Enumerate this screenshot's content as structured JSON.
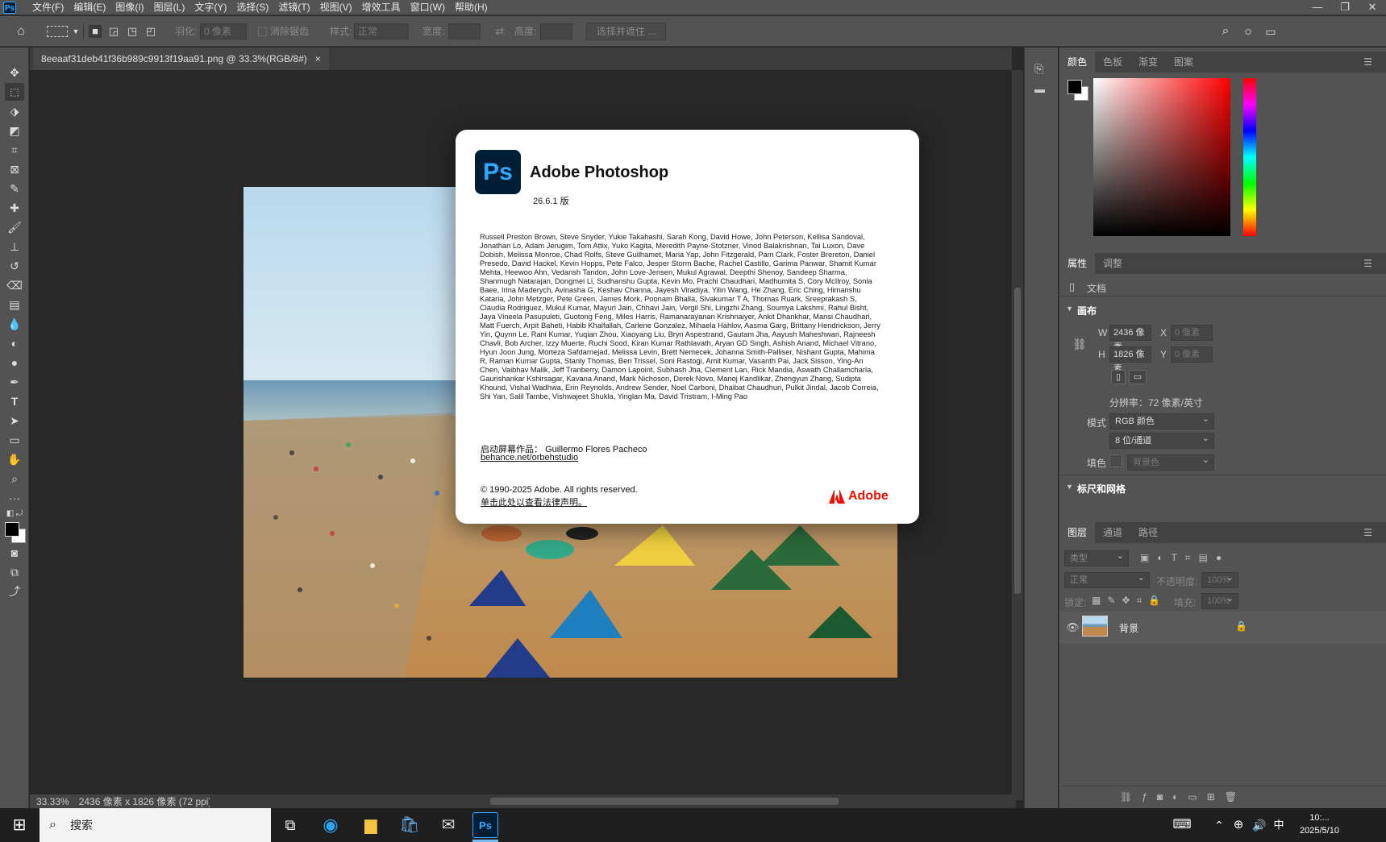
{
  "menubar": {
    "app_icon": "Ps",
    "items": [
      "文件(F)",
      "编辑(E)",
      "图像(I)",
      "图层(L)",
      "文字(Y)",
      "选择(S)",
      "滤镜(T)",
      "视图(V)",
      "增效工具",
      "窗口(W)",
      "帮助(H)"
    ],
    "window_controls": [
      "—",
      "❐",
      "✕"
    ]
  },
  "options_bar": {
    "feather_label": "羽化:",
    "feather_value": "0 像素",
    "antialias_label": "消除锯齿",
    "style_label": "样式:",
    "style_value": "正常",
    "width_label": "宽度:",
    "height_label": "高度:",
    "select_mask_button": "选择并遮住 ..."
  },
  "document_tab": {
    "title": "8eeaaf31deb41f36b989c9913f19aa91.png @ 33.3%(RGB/8#)",
    "close": "×"
  },
  "status_bar": {
    "zoom": "33.33%",
    "info": "2436 像素 x 1826 像素 (72 ppi)"
  },
  "about_dialog": {
    "logo": "Ps",
    "title": "Adobe Photoshop",
    "version": "26.6.1 版",
    "credits": "Russell Preston Brown, Steve Snyder, Yukie Takahashi, Sarah Kong, David Howe, John Peterson, Kellisa Sandoval, Jonathan Lo, Adam Jerugim, Tom Attix, Yuko Kagita, Meredith Payne-Stotzner, Vinod Balakrishnan, Tai Luxon, Dave Dobish, Melissa Monroe, Chad Rolfs, Steve Guilhamet, Maria Yap, John Fitzgerald, Pam Clark, Foster Brereton, Daniel Presedo, David Hackel, Kevin Hopps, Pete Falco, Jesper Storm Bache, Rachel Castillo, Garima Panwar, Shamit Kumar Mehta, Heewoo Ahn, Vedansh Tandon, John Love-Jensen, Mukul Agrawal, Deepthi Shenoy, Sandeep Sharma, Shanmugh Natarajan, Dongmei Li, Sudhanshu Gupta, Kevin Mo, Prachi Chaudhari, Madhumita S, Cory McIlroy, Sonia Baee, Irina Maderych, Avinasha G, Keshav Channa, Jayesh Viradiya, Yilin Wang, He Zhang, Eric Ching, Himanshu Kataria, John Metzger, Pete Green, James Mork, Poonam Bhalla, Sivakumar T A, Thomas Ruark, Sreeprakash S, Claudia Rodriguez, Mukul Kumar, Mayuri Jain, Chhavi Jain, Vergil Shi, Lingzhi Zhang, Soumya Lakshmi, Rahul Bisht, Jaya Vineela Pasupuleti, Guotong Feng, Miles Harris, Ramanarayanan Krishnaiyer, Ankit Dhankhar, Mansi Chaudhari, Matt Fuerch, Arpit Baheti, Habib Khalfallah, Carlene Gonzalez, Mihaela Hahlov, Aasma Garg, Brittany Hendrickson, Jerry Yin, Quynn Le, Rani Kumar, Yuqian Zhou, Xiaoyang Liu, Bryn Aspestrand, Gautam Jha, Aayush Maheshwari, Rajneesh Chavli, Bob Archer, Izzy Muerte, Ruchi Sood, Kiran Kumar Rathlavath, Aryan GD Singh, Ashish Anand, Michael Vitrano, Hyun Joon Jung, Morteza Safdarnejad, Melissa Levin, Brett Nemecek, Johanna Smith-Palliser, Nishant Gupta, Mahima R, Raman Kumar Gupta, Stanly Thomas, Ben Trissel, Soni Rastogi, Amit Kumar, Vasanth Pai, Jack Sisson, Ying-An Chen, Vaibhav Malik, Jeff Tranberry, Damon Lapoint, Subhash Jha, Clement Lan, Rick Mandia, Aswath Challamcharla, Gaurishankar Kshirsagar, Kavana Anand, Mark Nichoson, Derek Novo, Manoj Kandlikar, Zhengyun Zhang, Sudipta Khound, Vishal Wadhwa, Erin Reynolds, Andrew Sender, Noel Carboni, Dhaibat Chaudhuri, Pulkit Jindal, Jacob Correia, Shi Yan, Salil Tambe, Vishwajeet Shukla, Yinglan Ma, David Tristram, I-Ming Pao",
    "splash_label": "启动屏幕作品：",
    "splash_artist": "Guillermo Flores Pacheco",
    "splash_link": "behance.net/orbehstudio",
    "copyright": "© 1990-2025 Adobe. All rights reserved.",
    "legal_link": "单击此处以查看法律声明。",
    "brand": "Adobe"
  },
  "color_panel": {
    "tabs": [
      "颜色",
      "色板",
      "渐变",
      "图案"
    ],
    "foreground": "#000000",
    "background": "#ffffff",
    "hue": "#ff0000"
  },
  "properties_panel": {
    "tabs": [
      "属性",
      "调整"
    ],
    "doc_label": "文档",
    "canvas_section": "画布",
    "w_label": "W",
    "w_value": "2436 像素",
    "h_label": "H",
    "h_value": "1826 像素",
    "x_label": "X",
    "x_placeholder": "0 像素",
    "y_label": "Y",
    "y_placeholder": "0 像素",
    "resolution": "分辨率：72 像素/英寸",
    "mode_label": "模式",
    "mode_value": "RGB 颜色",
    "depth_value": "8 位/通道",
    "fill_label": "填色",
    "fill_value": "背景色",
    "rulers_section": "标尺和网格"
  },
  "layers_panel": {
    "tabs": [
      "图层",
      "通道",
      "路径"
    ],
    "filter_placeholder": "类型",
    "blend_mode": "正常",
    "opacity_label": "不透明度:",
    "opacity_value": "100%",
    "lock_label": "锁定:",
    "fill_label": "填充:",
    "fill_value": "100%",
    "layer_name": "背景"
  },
  "taskbar": {
    "search_placeholder": "搜索",
    "ime": "中",
    "time": "10:...",
    "date": "2025/5/10"
  }
}
